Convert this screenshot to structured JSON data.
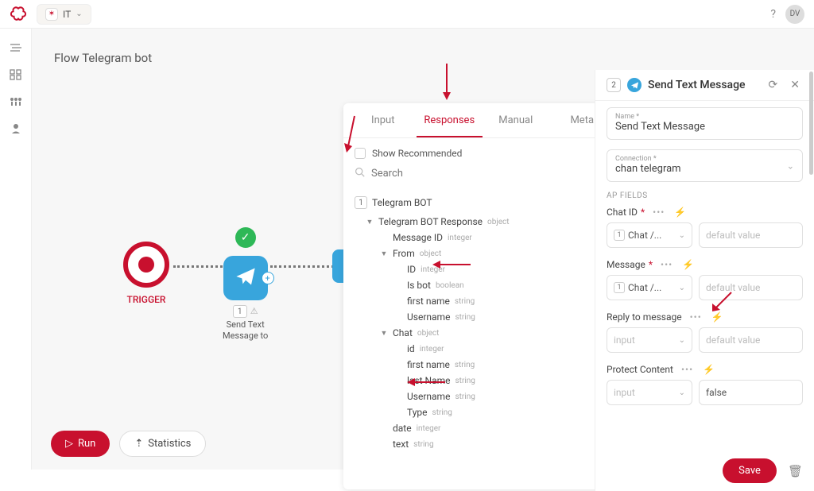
{
  "workspace": {
    "label": "IT"
  },
  "user": {
    "initials": "DV"
  },
  "flow": {
    "title": "Flow Telegram bot"
  },
  "trigger": {
    "label": "TRIGGER"
  },
  "sendNode": {
    "index": "1",
    "caption_l1": "Send Text",
    "caption_l2": "Message to"
  },
  "run": {
    "label": "Run"
  },
  "stats": {
    "label": "Statistics"
  },
  "tabs": {
    "input": "Input",
    "responses": "Responses",
    "manual": "Manual",
    "meta": "Meta"
  },
  "showRec": "Show Recommended",
  "searchPh": "Search",
  "tree": {
    "root_idx": "1",
    "root": "Telegram BOT",
    "resp": "Telegram BOT Response",
    "obj": "object",
    "msgid": "Message ID",
    "int": "integer",
    "from": "From",
    "id": "ID",
    "isbot": "Is bot",
    "bool": "boolean",
    "fname": "first name",
    "str": "string",
    "uname": "Username",
    "chat": "Chat",
    "chat_id": "id",
    "lname": "last Name",
    "type": "Type",
    "date": "date",
    "text": "text"
  },
  "rpanel": {
    "idx": "2",
    "title": "Send Text Message",
    "name_mini": "Name *",
    "name_val": "Send Text Message",
    "conn_mini": "Connection *",
    "conn_val": "chan telegram",
    "sect": "AP FIELDS",
    "chatid": "Chat ID",
    "sel_chat": "Chat /...",
    "sel_idx": "1",
    "ph_default": "default value",
    "message": "Message",
    "reply": "Reply to message",
    "sel_input": "input",
    "protect": "Protect Content",
    "false": "false",
    "save": "Save"
  }
}
